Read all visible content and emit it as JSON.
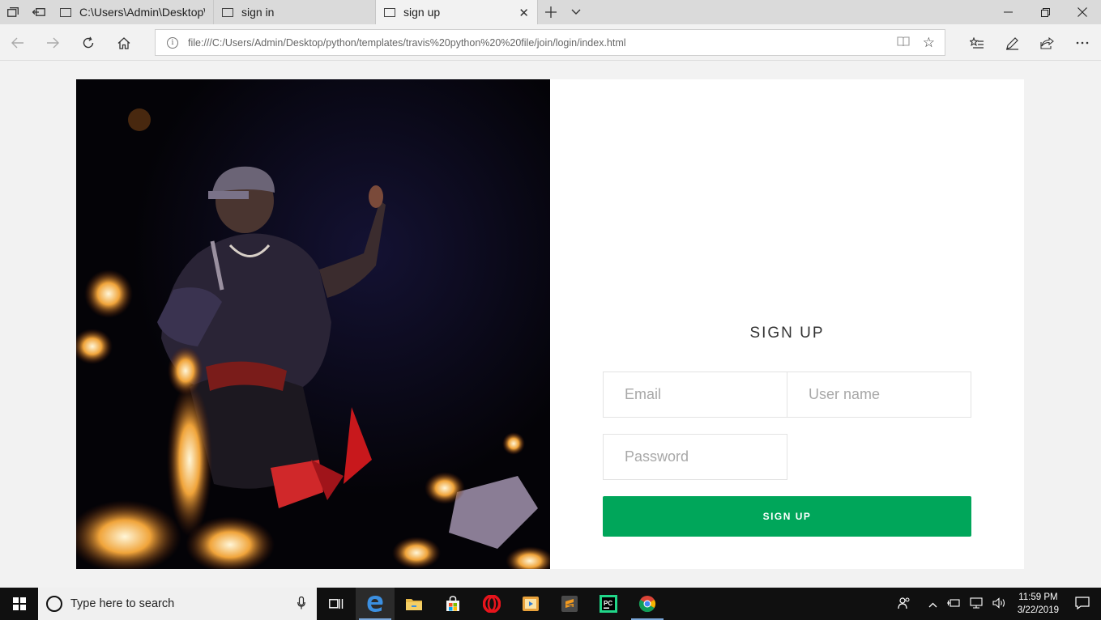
{
  "browser": {
    "tabs": [
      {
        "title": "C:\\Users\\Admin\\Desktop\\py",
        "active": false
      },
      {
        "title": "sign in",
        "active": false
      },
      {
        "title": "sign up",
        "active": true
      }
    ],
    "url": "file:///C:/Users/Admin/Desktop/python/templates/travis%20python%20%20file/join/login/index.html"
  },
  "signup": {
    "title": "SIGN UP",
    "email_placeholder": "Email",
    "username_placeholder": "User name",
    "password_placeholder": "Password",
    "button_label": "SIGN UP",
    "button_color": "#00a65a"
  },
  "taskbar": {
    "search_placeholder": "Type here to search",
    "time": "11:59 PM",
    "date": "3/22/2019"
  }
}
